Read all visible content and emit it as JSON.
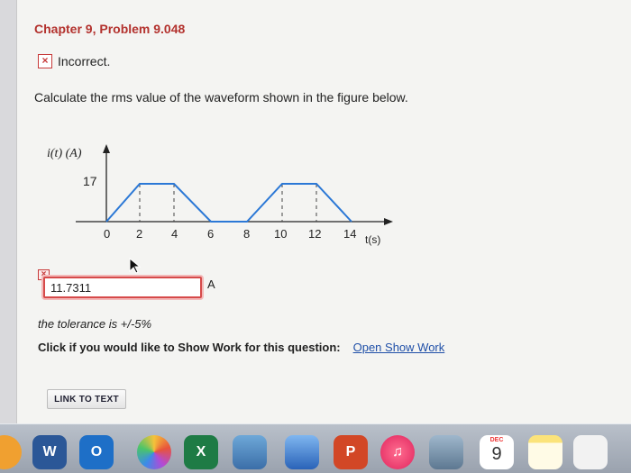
{
  "problem": {
    "title": "Chapter 9, Problem 9.048",
    "status": "Incorrect.",
    "question": "Calculate the rms value of the waveform shown in the figure below."
  },
  "figure": {
    "y_axis_label": "i(t) (A)",
    "x_axis_label": "t(s)",
    "peak_label": "17",
    "x_ticks": [
      "0",
      "2",
      "4",
      "6",
      "8",
      "10",
      "12",
      "14"
    ]
  },
  "answer": {
    "value": "11.7311",
    "unit": "A",
    "flag_symbol": "×"
  },
  "tolerance": "the tolerance is +/-5%",
  "show_work": {
    "label": "Click if you would like to Show Work for this question:",
    "link": "Open Show Work"
  },
  "link_to_text": "LINK TO TEXT",
  "dock": {
    "word_letter": "W",
    "outlook_letter": "O",
    "excel_letter": "X",
    "powerpoint_letter": "P",
    "calendar_month": "DEC",
    "calendar_day": "9"
  },
  "colors": {
    "title_red": "#b3322e",
    "waveform_blue": "#2b78d6",
    "link_blue": "#1f4fa8"
  }
}
